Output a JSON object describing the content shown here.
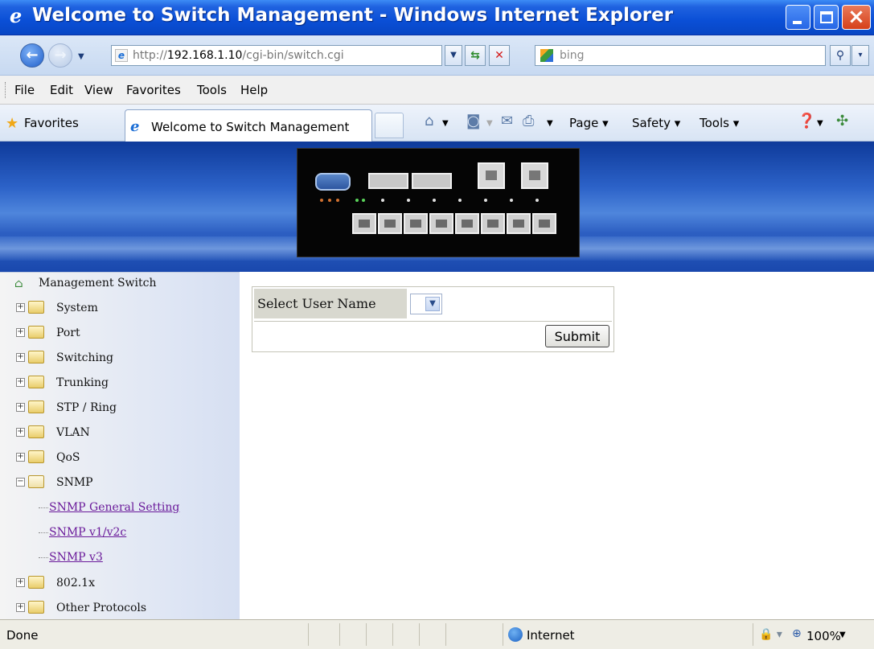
{
  "window": {
    "title": "Welcome to Switch Management - Windows Internet Explorer"
  },
  "address": {
    "url_prefix": "http://",
    "url_host": "192.168.1.10",
    "url_path": "/cgi-bin/switch.cgi",
    "search_placeholder": "bing"
  },
  "menu": {
    "items": [
      "File",
      "Edit",
      "View",
      "Favorites",
      "Tools",
      "Help"
    ]
  },
  "favorites_bar": {
    "favorites_label": "Favorites",
    "tab_title": "Welcome to Switch Management",
    "commands": {
      "page": "Page",
      "safety": "Safety",
      "tools": "Tools"
    }
  },
  "sidebar": {
    "root": "Management Switch",
    "nodes": [
      {
        "label": "System"
      },
      {
        "label": "Port"
      },
      {
        "label": "Switching"
      },
      {
        "label": "Trunking"
      },
      {
        "label": "STP / Ring"
      },
      {
        "label": "VLAN"
      },
      {
        "label": "QoS"
      },
      {
        "label": "SNMP"
      },
      {
        "label": "802.1x"
      },
      {
        "label": "Other Protocols"
      }
    ],
    "snmp_children": [
      {
        "label": "SNMP General Setting"
      },
      {
        "label": "SNMP v1/v2c"
      },
      {
        "label": "SNMP v3"
      }
    ]
  },
  "form": {
    "select_user_label": "Select User Name",
    "submit_label": "Submit"
  },
  "status": {
    "text": "Done",
    "zone": "Internet",
    "zoom": "100%"
  },
  "colors": {
    "titlebar": "#0a4fd6",
    "banner": "#2c62c8",
    "visited_link": "#6a1a9a",
    "form_label_bg": "#d8d8cf"
  }
}
